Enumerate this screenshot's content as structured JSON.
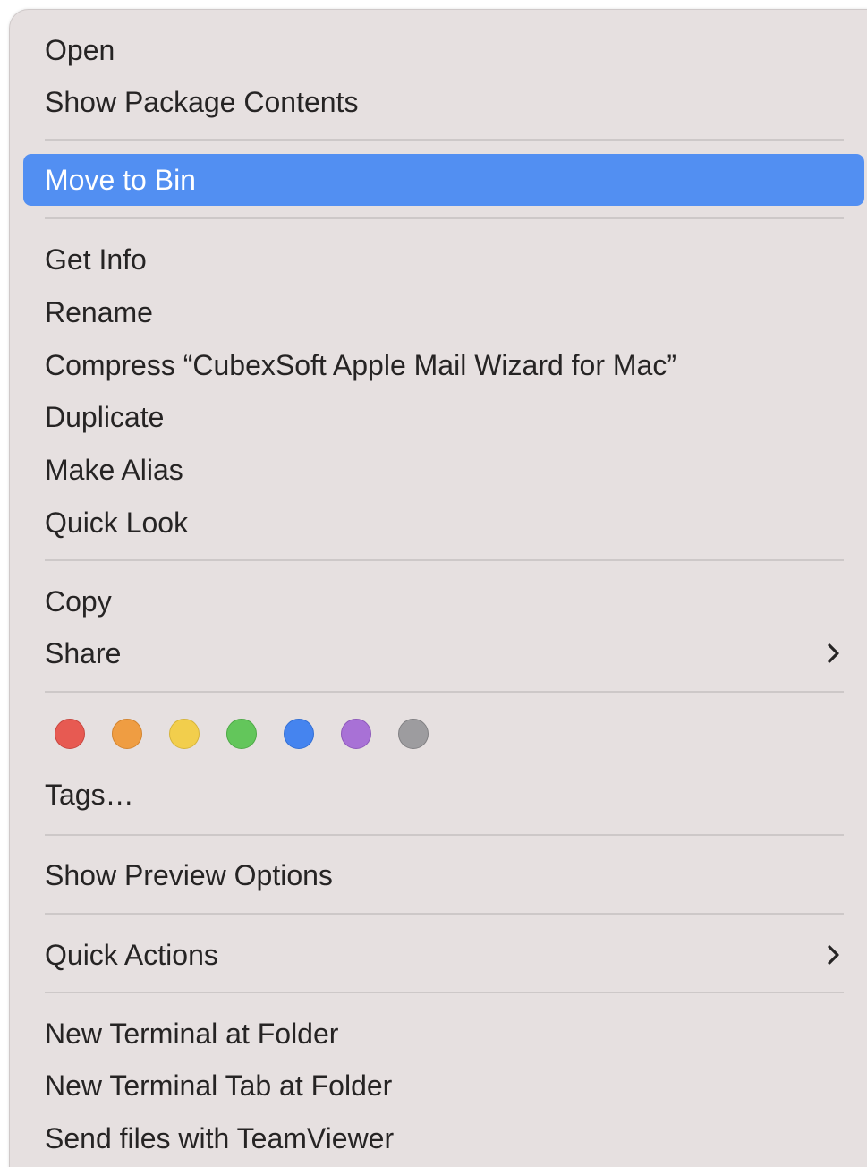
{
  "menu": {
    "groups": [
      {
        "items": [
          {
            "label": "Open"
          },
          {
            "label": "Show Package Contents"
          }
        ]
      },
      {
        "items": [
          {
            "label": "Move to Bin",
            "highlighted": true
          }
        ]
      },
      {
        "items": [
          {
            "label": "Get Info"
          },
          {
            "label": "Rename"
          },
          {
            "label": "Compress “CubexSoft Apple Mail Wizard for Mac”"
          },
          {
            "label": "Duplicate"
          },
          {
            "label": "Make Alias"
          },
          {
            "label": "Quick Look"
          }
        ]
      },
      {
        "items": [
          {
            "label": "Copy"
          },
          {
            "label": "Share",
            "submenu_icon": "chevron-right-icon"
          }
        ]
      },
      {
        "items": [
          {
            "label": "Tags…"
          }
        ]
      },
      {
        "items": [
          {
            "label": "Show Preview Options"
          }
        ]
      },
      {
        "items": [
          {
            "label": "Quick Actions",
            "submenu_icon": "chevron-right-icon"
          }
        ]
      },
      {
        "items": [
          {
            "label": "New Terminal at Folder"
          },
          {
            "label": "New Terminal Tab at Folder"
          },
          {
            "label": "Send files with TeamViewer"
          }
        ]
      }
    ],
    "tag_colors": [
      {
        "name": "red",
        "color": "#e75a52",
        "border": "#c84740"
      },
      {
        "name": "orange",
        "color": "#ef9d42",
        "border": "#d3842f"
      },
      {
        "name": "yellow",
        "color": "#f2ce4c",
        "border": "#d6b43a"
      },
      {
        "name": "green",
        "color": "#63c65b",
        "border": "#4ea947"
      },
      {
        "name": "blue",
        "color": "#4584ef",
        "border": "#336fd4"
      },
      {
        "name": "purple",
        "color": "#a871d6",
        "border": "#8e59bb"
      },
      {
        "name": "gray",
        "color": "#9d9c9f",
        "border": "#818083"
      }
    ],
    "highlight_color": "#528ff2"
  }
}
